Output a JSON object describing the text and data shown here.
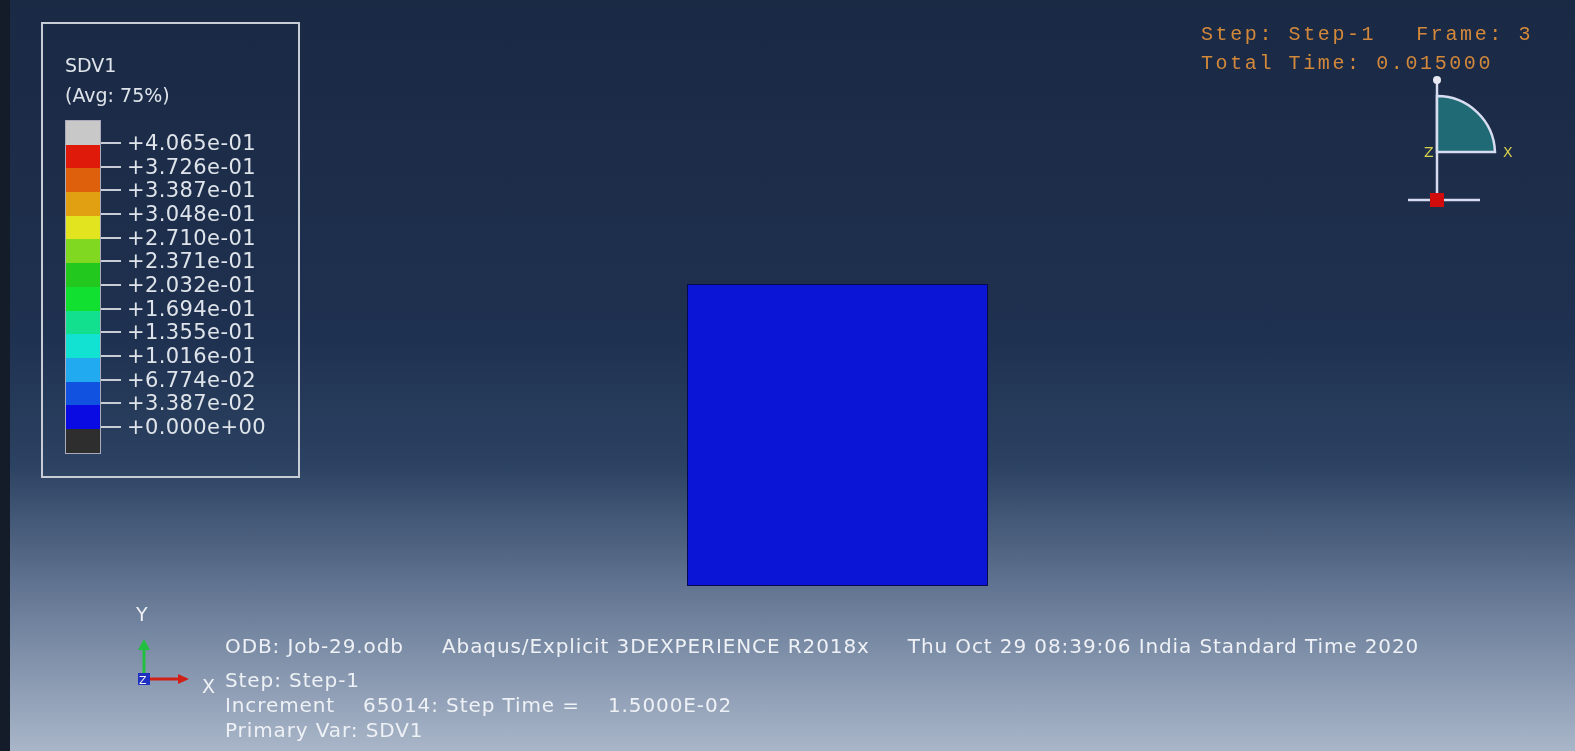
{
  "legend": {
    "title": "SDV1",
    "subtitle": "(Avg: 75%)",
    "swatches": [
      {
        "color": "#c8c8c8"
      },
      {
        "color": "#e01a0a"
      },
      {
        "color": "#de600c"
      },
      {
        "color": "#e0a012"
      },
      {
        "color": "#e2e420"
      },
      {
        "color": "#80d820"
      },
      {
        "color": "#22c81e"
      },
      {
        "color": "#12e030"
      },
      {
        "color": "#12e08e"
      },
      {
        "color": "#12e2d2"
      },
      {
        "color": "#22aaf0"
      },
      {
        "color": "#1252e0"
      },
      {
        "color": "#0a0ae2"
      },
      {
        "color": "#2e2e2e"
      }
    ],
    "labels": [
      "+4.065e-01",
      "+3.726e-01",
      "+3.387e-01",
      "+3.048e-01",
      "+2.710e-01",
      "+2.371e-01",
      "+2.032e-01",
      "+1.694e-01",
      "+1.355e-01",
      "+1.016e-01",
      "+6.774e-02",
      "+3.387e-02",
      "+0.000e+00"
    ]
  },
  "frame_info": {
    "step": "Step: Step-1",
    "frame": "Frame: 3",
    "total_time": "Total Time: 0.015000"
  },
  "view_triad": {
    "axis_labels": [
      "Z",
      "X"
    ]
  },
  "global_triad": {
    "axis_labels": [
      "Y",
      "Z",
      "X"
    ]
  },
  "info": {
    "odb": "ODB: Job-29.odb",
    "solver": "Abaqus/Explicit 3DEXPERIENCE R2018x",
    "date": "Thu Oct 29 08:39:06 India Standard Time 2020",
    "step": "Step: Step-1",
    "increment": {
      "label": "Increment",
      "value": "65014: Step Time =",
      "time": "1.5000E-02"
    },
    "primary_var": "Primary Var: SDV1"
  }
}
